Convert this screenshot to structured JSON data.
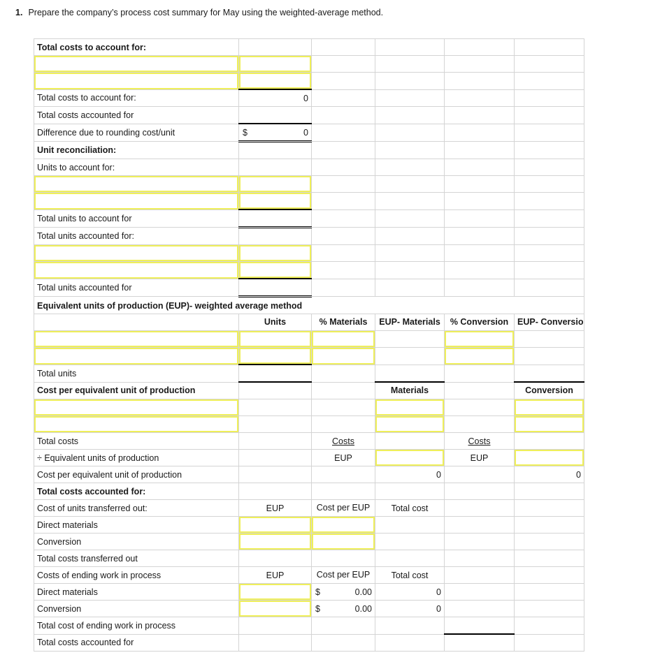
{
  "question": {
    "number": "1.",
    "text": "Prepare the company’s process cost summary for May using the weighted-average method."
  },
  "sheet": {
    "sections": {
      "total_costs_to_account_for": "Total costs to account for:",
      "unit_reconciliation": "Unit reconciliation:",
      "eup_header": "Equivalent units of production (EUP)- weighted average method",
      "cost_per_eup_header": "Cost per equivalent unit of production",
      "total_costs_accounted_for_header": "Total costs accounted for:"
    },
    "labels": {
      "total_costs_to_account_for": "Total costs to account for:",
      "total_costs_accounted_for": "Total costs accounted for",
      "difference_rounding": "Difference due to rounding cost/unit",
      "units_to_account_for": "Units to account for:",
      "total_units_to_account_for": "Total units to account for",
      "total_units_accounted_for_colon": "Total units accounted for:",
      "total_units_accounted_for": "Total units accounted for",
      "total_units": "Total units",
      "total_costs": "Total costs",
      "divide_eup": "÷ Equivalent units of production",
      "cost_per_eup": "Cost per equivalent unit of production",
      "cost_of_units_transferred_out": "Cost of units transferred out:",
      "direct_materials": "Direct materials",
      "conversion": "Conversion",
      "total_costs_transferred_out": "Total costs transferred out",
      "costs_of_ending_wip": "Costs of ending work in process",
      "total_cost_of_ending_wip": "Total cost of ending work in process",
      "total_costs_accounted_for_bottom": "Total costs accounted for"
    },
    "column_headers": {
      "units": "Units",
      "pct_materials": "% Materials",
      "eup_materials": "EUP- Materials",
      "pct_conversion": "% Conversion",
      "eup_conversion": "EUP-\nConversion"
    },
    "inline_headers": {
      "materials": "Materials",
      "conversion": "Conversion",
      "costs": "Costs",
      "eup": "EUP",
      "cost_per_eup": "Cost per\nEUP",
      "total_cost": "Total cost"
    },
    "values": {
      "total_costs_to_account_for_amount": "0",
      "difference_symbol": "$",
      "difference_amount": "0",
      "cost_per_eup_materials": "0",
      "cost_per_eup_conversion": "0",
      "wip_dm_symbol": "$",
      "wip_dm_rate": "0.00",
      "wip_dm_total": "0",
      "wip_conv_symbol": "$",
      "wip_conv_rate": "0.00",
      "wip_conv_total": "0"
    },
    "colors": {
      "header_blue": "#8FAADC",
      "input_border_yellow": "#EFEF5A",
      "computed_fill_yellow": "#FFFBAF",
      "grid_gray": "#D4D4D4"
    }
  }
}
